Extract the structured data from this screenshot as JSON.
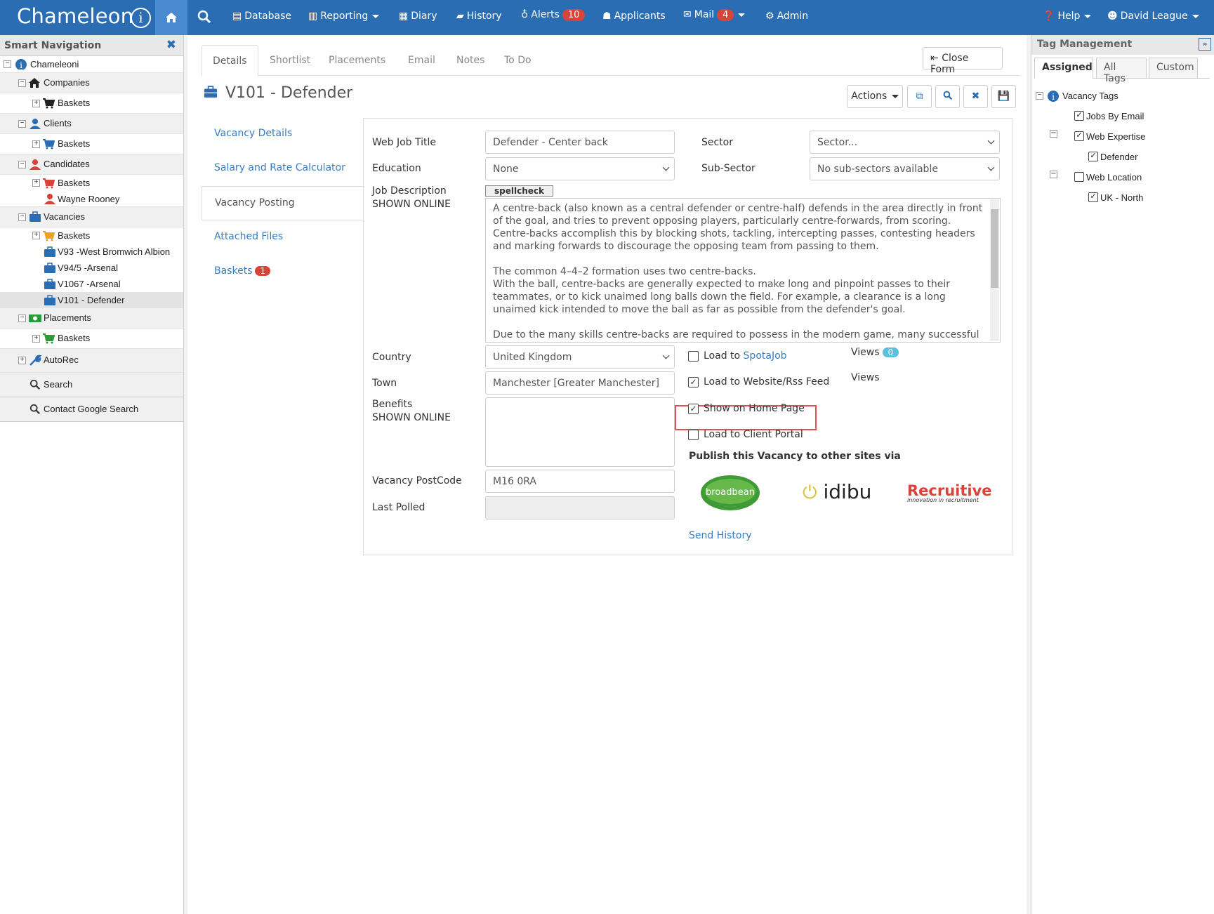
{
  "topbar": {
    "app_name": "Chameleon",
    "nav": [
      {
        "label": "Database",
        "icon": "database-icon"
      },
      {
        "label": "Reporting",
        "icon": "bar-chart-icon"
      },
      {
        "label": "Diary",
        "icon": "calendar-icon"
      },
      {
        "label": "History",
        "icon": "book-icon"
      },
      {
        "label": "Alerts",
        "icon": "lightbulb-icon",
        "badge": "10"
      },
      {
        "label": "Applicants",
        "icon": "users-icon"
      },
      {
        "label": "Mail",
        "icon": "envelope-icon",
        "badge": "4"
      },
      {
        "label": "Admin",
        "icon": "cogs-icon"
      }
    ],
    "help": "Help",
    "user": "David League",
    "colors": {
      "bar": "#2a6db3",
      "home": "#4a8ad0",
      "badge": "#d9443a"
    }
  },
  "left_panel": {
    "title": "Smart Navigation",
    "tree": [
      {
        "label": "Chameleoni"
      },
      {
        "label": "Companies"
      },
      {
        "label": "Baskets"
      },
      {
        "label": "Clients"
      },
      {
        "label": "Baskets"
      },
      {
        "label": "Candidates"
      },
      {
        "label": "Baskets"
      },
      {
        "label": "Wayne Rooney"
      },
      {
        "label": "Vacancies"
      },
      {
        "label": "Baskets"
      },
      {
        "label": "V93 -West Bromwich Albion"
      },
      {
        "label": "V94/5 -Arsenal"
      },
      {
        "label": "V1067 -Arsenal"
      },
      {
        "label": "V101 - Defender"
      },
      {
        "label": "Placements"
      },
      {
        "label": "Baskets"
      },
      {
        "label": "AutoRec"
      },
      {
        "label": "Search"
      },
      {
        "label": "Contact Google Search"
      }
    ]
  },
  "main": {
    "tabs": [
      "Details",
      "Shortlist",
      "Placements",
      "Email",
      "Notes",
      "To Do"
    ],
    "close_form": "Close Form",
    "title": "V101 - Defender",
    "actions": "Actions",
    "side_menu": [
      "Vacancy Details",
      "Salary and Rate Calculator",
      "Vacancy Posting",
      "Attached Files",
      "Baskets"
    ],
    "baskets_badge": "1",
    "form": {
      "web_job_title_label": "Web Job Title",
      "web_job_title": "Defender - Center back",
      "sector_label": "Sector",
      "sector": "Sector...",
      "education_label": "Education",
      "education": "None",
      "subsector_label": "Sub-Sector",
      "subsector": "No sub-sectors available",
      "job_desc_label": "Job Description",
      "shown_online": "SHOWN ONLINE",
      "spellcheck": "spellcheck",
      "job_desc_paragraphs": [
        "A centre-back (also known as a central defender or centre-half) defends in the area directly in front of the goal, and tries to prevent opposing players, particularly centre-forwards, from scoring. Centre-backs accomplish this by blocking shots, tackling, intercepting passes, contesting headers and marking forwards to discourage the opposing team from passing to them.",
        "The common 4–4–2 formation uses two centre-backs.\nWith the ball, centre-backs are generally expected to make long and pinpoint passes to their teammates, or to kick unaimed long balls down the field. For example, a clearance is a long unaimed kick intended to move the ball as far as possible from the defender's goal.",
        "Due to the many skills centre-backs are required to possess in the modern game, many successful"
      ],
      "country_label": "Country",
      "country": "United Kingdom",
      "town_label": "Town",
      "town": "Manchester [Greater Manchester]",
      "benefits_label": "Benefits",
      "postcode_label": "Vacancy PostCode",
      "postcode": "M16 0RA",
      "last_polled_label": "Last Polled",
      "load_to": "Load to",
      "spotajob": "SpotaJob",
      "load_website": "Load to Website/Rss Feed",
      "show_home": "Show on Home Page",
      "load_client": "Load to Client Portal",
      "views_label": "Views",
      "views_count": "0",
      "publish_heading": "Publish this Vacancy to other sites via",
      "broadbean": "broadbean",
      "idibu": "idibu",
      "recruitive": "Recruitive",
      "recruitive_tagline": "innovation in recruitment",
      "send_history": "Send History"
    }
  },
  "right_panel": {
    "title": "Tag Management",
    "tabs": [
      "Assigned",
      "All Tags",
      "Custom"
    ],
    "tags": [
      {
        "label": "Vacancy Tags",
        "checked": null
      },
      {
        "label": "Jobs By Email",
        "checked": true
      },
      {
        "label": "Web Expertise",
        "checked": true
      },
      {
        "label": "Defender",
        "checked": true
      },
      {
        "label": "Web Location",
        "checked": false
      },
      {
        "label": "UK - North",
        "checked": true
      }
    ]
  }
}
